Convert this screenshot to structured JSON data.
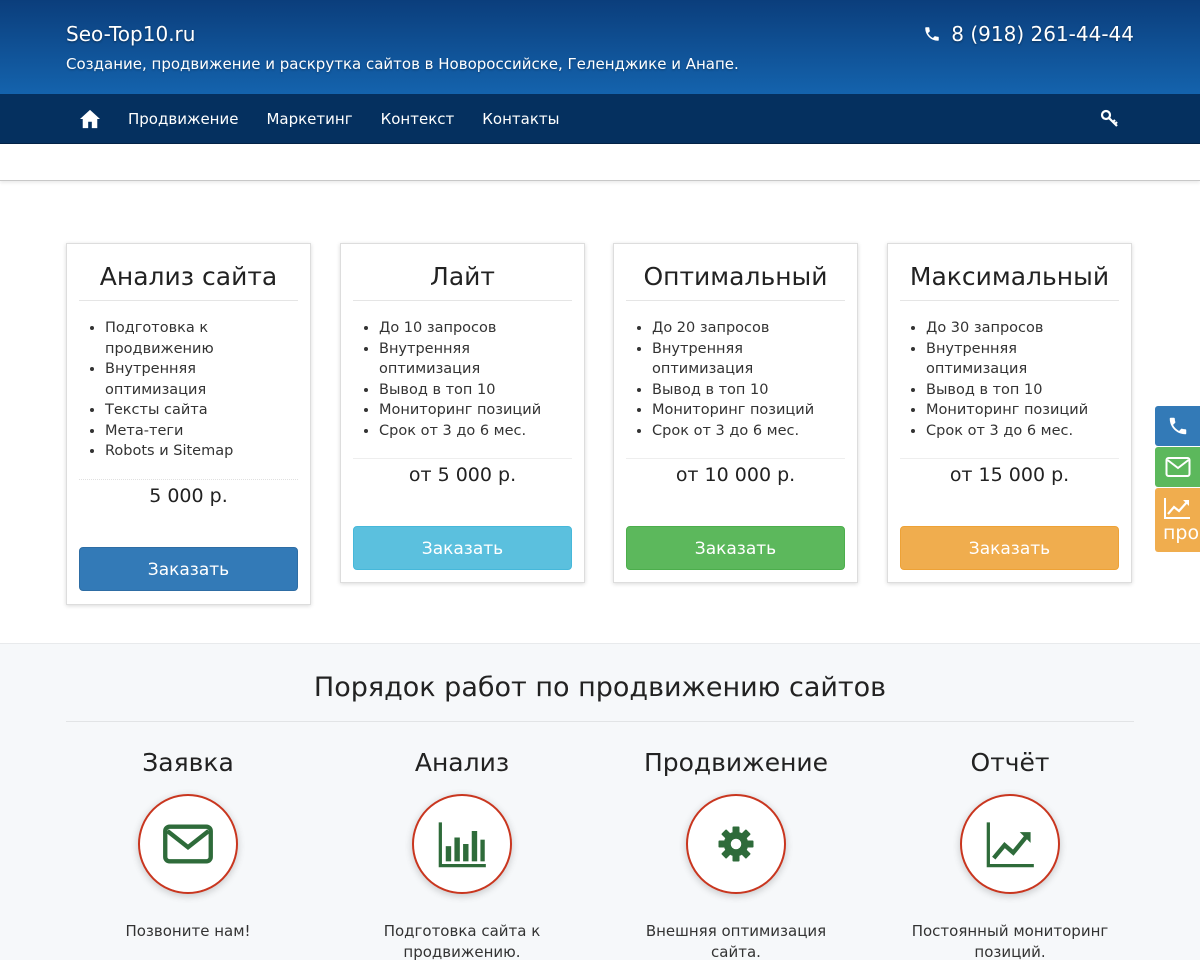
{
  "header": {
    "brand": "Seo-Top10.ru",
    "tagline": "Создание, продвижение и раскрутка сайтов в Новороссийске, Геленджике и Анапе.",
    "phone": "8 (918) 261-44-44"
  },
  "nav": {
    "items": [
      "Продвижение",
      "Маркетинг",
      "Контекст",
      "Контакты"
    ]
  },
  "plans": [
    {
      "title": "Анализ сайта",
      "features": [
        "Подготовка к продвижению",
        "Внутренняя оптимизация",
        "Тексты сайта",
        "Мета-теги",
        "Robots и Sitemap"
      ],
      "price": "5 000 р.",
      "button": "Заказать",
      "color": "#337ab7"
    },
    {
      "title": "Лайт",
      "features": [
        "До 10 запросов",
        "Внутренняя оптимизация",
        "Вывод в топ 10",
        "Мониторинг позиций",
        "Срок от 3 до 6 мес."
      ],
      "price": "от 5 000 р.",
      "button": "Заказать",
      "color": "#5bc0de"
    },
    {
      "title": "Оптимальный",
      "features": [
        "До 20 запросов",
        "Внутренняя оптимизация",
        "Вывод в топ 10",
        "Мониторинг позиций",
        "Срок от 3 до 6 мес."
      ],
      "price": "от 10 000 р.",
      "button": "Заказать",
      "color": "#5cb85c"
    },
    {
      "title": "Максимальный",
      "features": [
        "До 30 запросов",
        "Внутренняя оптимизация",
        "Вывод в топ 10",
        "Мониторинг позиций",
        "Срок от 3 до 6 мес."
      ],
      "price": "от 15 000 р.",
      "button": "Заказать",
      "color": "#f0ad4e"
    }
  ],
  "process": {
    "title": "Порядок работ по продвижению сайтов",
    "steps": [
      {
        "title": "Заявка",
        "text": "Позвоните нам!",
        "icon": "envelope-icon"
      },
      {
        "title": "Анализ",
        "text": "Подготовка сайта к продвижению.",
        "icon": "bar-chart-icon"
      },
      {
        "title": "Продвижение",
        "text": "Внешняя оптимизация сайта.",
        "icon": "gear-icon"
      },
      {
        "title": "Отчёт",
        "text": "Постоянный мониторинг позиций.",
        "icon": "line-chart-icon"
      }
    ]
  },
  "side_widgets": {
    "promo_label": "продвижение"
  },
  "colors": {
    "header_top": "#0b3e7c",
    "header_bottom": "#1463ad",
    "navbar": "#05305f",
    "circle_border": "#c9361f",
    "icon_green": "#2e6b3a",
    "widget_blue": "#337ab7",
    "widget_green": "#5cb85c",
    "widget_orange": "#f0ad4e"
  }
}
